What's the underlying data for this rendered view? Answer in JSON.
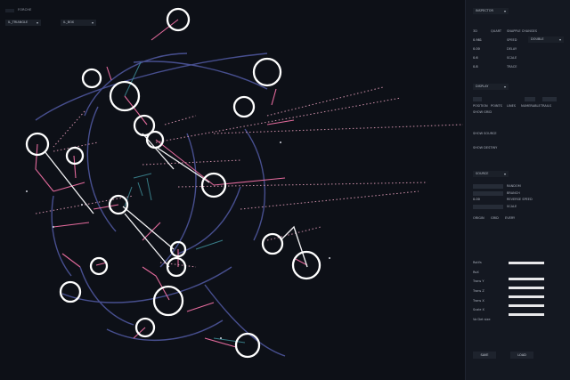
{
  "stage": {
    "title": "FORCHE",
    "selectors": [
      {
        "value": "IL_TRIANGLE"
      },
      {
        "value": "IL_BOX"
      }
    ]
  },
  "panel": {
    "section1": {
      "label": "INSPECTOR"
    },
    "tabs": [
      "3D",
      "QUART",
      "SNAPPLE CHANGES"
    ],
    "rows": [
      {
        "value": "0.981",
        "label": "SPEED",
        "dropdown": "DOUBLE"
      },
      {
        "value": "0.00",
        "label": "DELAY"
      },
      {
        "value": "0.6",
        "label": "SCALE"
      },
      {
        "value": "0.8",
        "label": "TRACE"
      }
    ],
    "section2": {
      "label": "DISPLAY"
    },
    "display_opts": [
      "POSITION",
      "POINTS",
      "LINES",
      "NUMERABLE",
      "TRAILS"
    ],
    "display_extra": "SHOW GRID",
    "show_source": "SHOW SOURCE",
    "show_destiny": "SHOW DESTINY",
    "section3": {
      "label": "SOURCE"
    },
    "source_rows": [
      {
        "label": "RANDOM"
      },
      {
        "label": "BRANCH"
      },
      {
        "value": "0.00",
        "label": "REVERSE SPEED"
      },
      {
        "label": "SCALE"
      }
    ],
    "source_tabs": [
      "ORIGIN",
      "GRID",
      "EVERY"
    ],
    "params": [
      {
        "label": "RotYa"
      },
      {
        "label": "RoX"
      },
      {
        "label": "Trans Y"
      },
      {
        "label": "Trans Z"
      },
      {
        "label": "Trans X"
      },
      {
        "label": "Scale X"
      },
      {
        "label": "Va Det size"
      }
    ],
    "save_label": "SAVE",
    "load_label": "LOAD"
  },
  "colors": {
    "background": "#0d1017",
    "panel": "#141821",
    "node": "#ffffff",
    "pink": "#e36a9c",
    "blue": "#6f7fd6",
    "teal": "#3f8f9a"
  }
}
